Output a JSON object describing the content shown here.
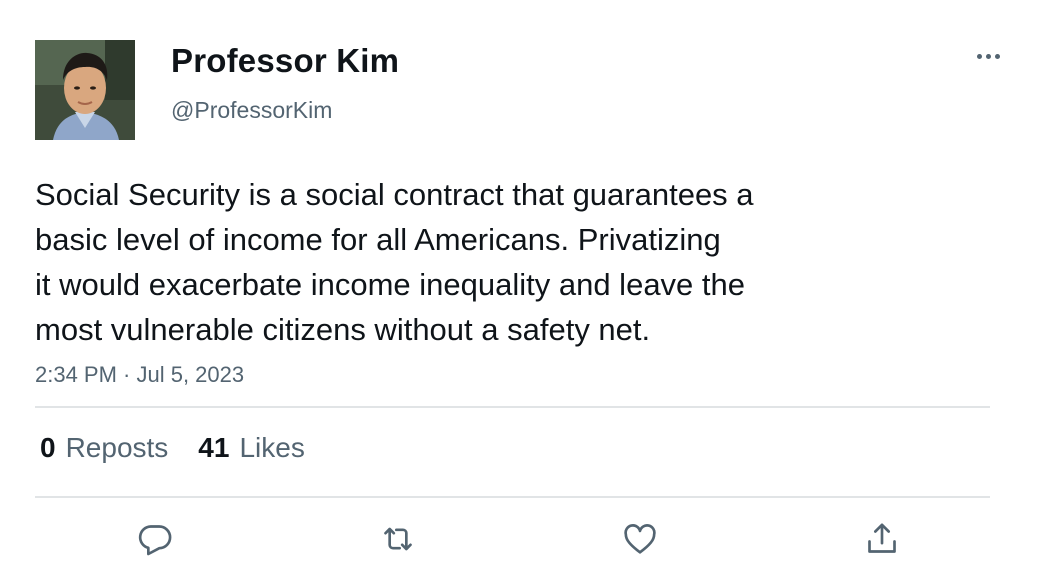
{
  "author": {
    "display_name": "Professor Kim",
    "handle": "@ProfessorKim",
    "avatar_icon": "profile-photo"
  },
  "tweet": {
    "lines": [
      "Social Security is a social contract that guarantees a",
      "basic level of income for all Americans. Privatizing",
      "it would exacerbate income inequality and leave the",
      "most vulnerable citizens without a safety net."
    ],
    "timestamp": "2:34 PM · Jul 5, 2023"
  },
  "stats": {
    "reposts_count": "0",
    "reposts_label": "Reposts",
    "likes_count": "41",
    "likes_label": "Likes"
  },
  "actions": {
    "reply_icon": "reply-icon",
    "repost_icon": "repost-icon",
    "like_icon": "heart-icon",
    "share_icon": "share-icon"
  },
  "colors": {
    "text": "#0f1419",
    "secondary": "#536471",
    "divider": "#e1e4e6"
  }
}
